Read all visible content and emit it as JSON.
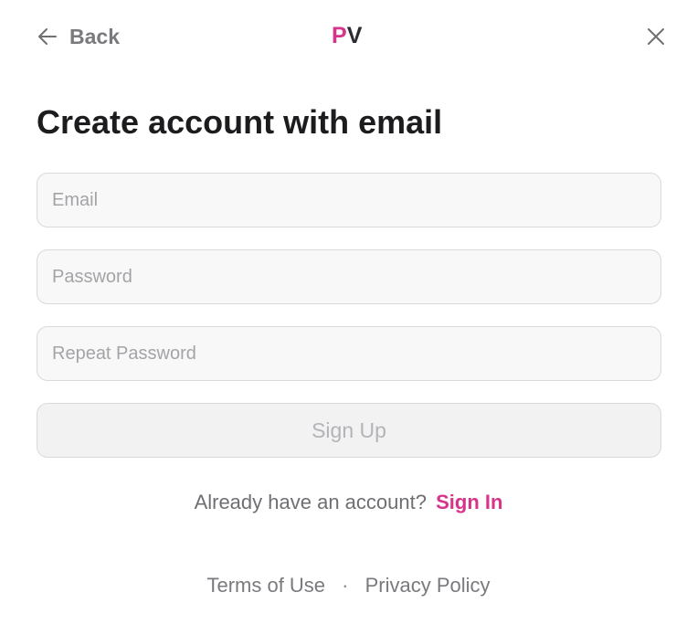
{
  "header": {
    "back_label": "Back",
    "logo_p": "P",
    "logo_v": "V",
    "back_icon": "arrow-left-icon",
    "close_icon": "close-icon"
  },
  "main": {
    "title": "Create account with email",
    "fields": {
      "email": {
        "placeholder": "Email",
        "value": ""
      },
      "password": {
        "placeholder": "Password",
        "value": ""
      },
      "repeat_password": {
        "placeholder": "Repeat Password",
        "value": ""
      }
    },
    "signup_label": "Sign Up",
    "signin_prompt": "Already have an account?",
    "signin_label": "Sign In"
  },
  "footer": {
    "terms_label": "Terms of Use",
    "separator": "·",
    "privacy_label": "Privacy Policy"
  },
  "colors": {
    "accent": "#d6338a",
    "text_primary": "#1c1c1e",
    "text_secondary": "#7a7a7e"
  }
}
